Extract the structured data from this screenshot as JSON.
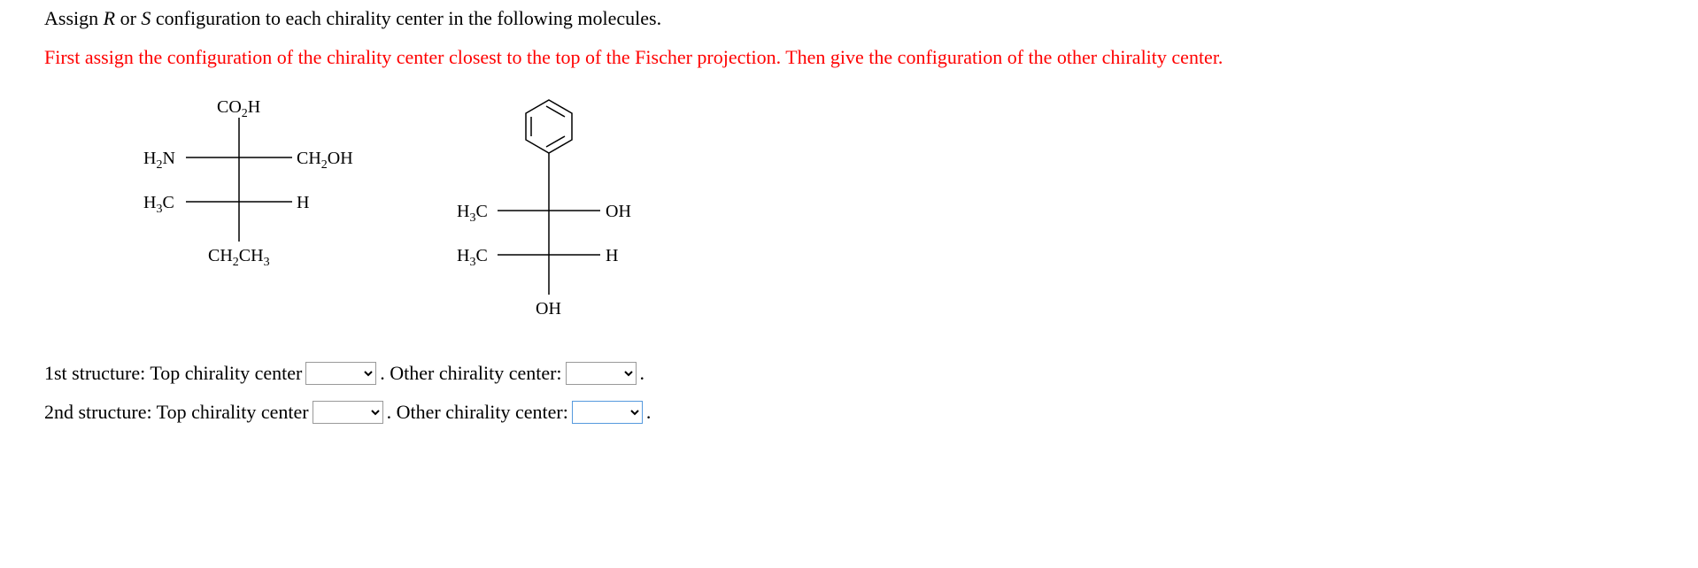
{
  "question": {
    "prefix": "Assign ",
    "r": "R",
    "or": " or ",
    "s": "S",
    "suffix": " configuration to each chirality center in the following molecules."
  },
  "instruction": "First assign the configuration of the chirality center closest to the top of the Fischer projection. Then give the configuration of the other chirality center.",
  "structure1": {
    "top": "CO",
    "top_sub": "2",
    "top_suffix": "H",
    "c1_left_prefix": "H",
    "c1_left_sub": "2",
    "c1_left_suffix": "N",
    "c1_right_prefix": "CH",
    "c1_right_sub": "2",
    "c1_right_suffix": "OH",
    "c2_left_prefix": "H",
    "c2_left_sub": "3",
    "c2_left_suffix": "C",
    "c2_right": "H",
    "bottom_prefix": "CH",
    "bottom_sub": "2",
    "bottom_mid": "CH",
    "bottom_sub2": "3"
  },
  "structure2": {
    "c1_left_prefix": "H",
    "c1_left_sub": "3",
    "c1_left_suffix": "C",
    "c1_right": "OH",
    "c2_left_prefix": "H",
    "c2_left_sub": "3",
    "c2_left_suffix": "C",
    "c2_right": "H",
    "bottom": "OH"
  },
  "answers": {
    "row1_label": "1st structure: Top chirality center",
    "row1_mid": ". Other chirality center: ",
    "row1_end": ".",
    "row2_label": "2nd structure: Top chirality center",
    "row2_mid": ". Other chirality center: ",
    "row2_end": "."
  }
}
